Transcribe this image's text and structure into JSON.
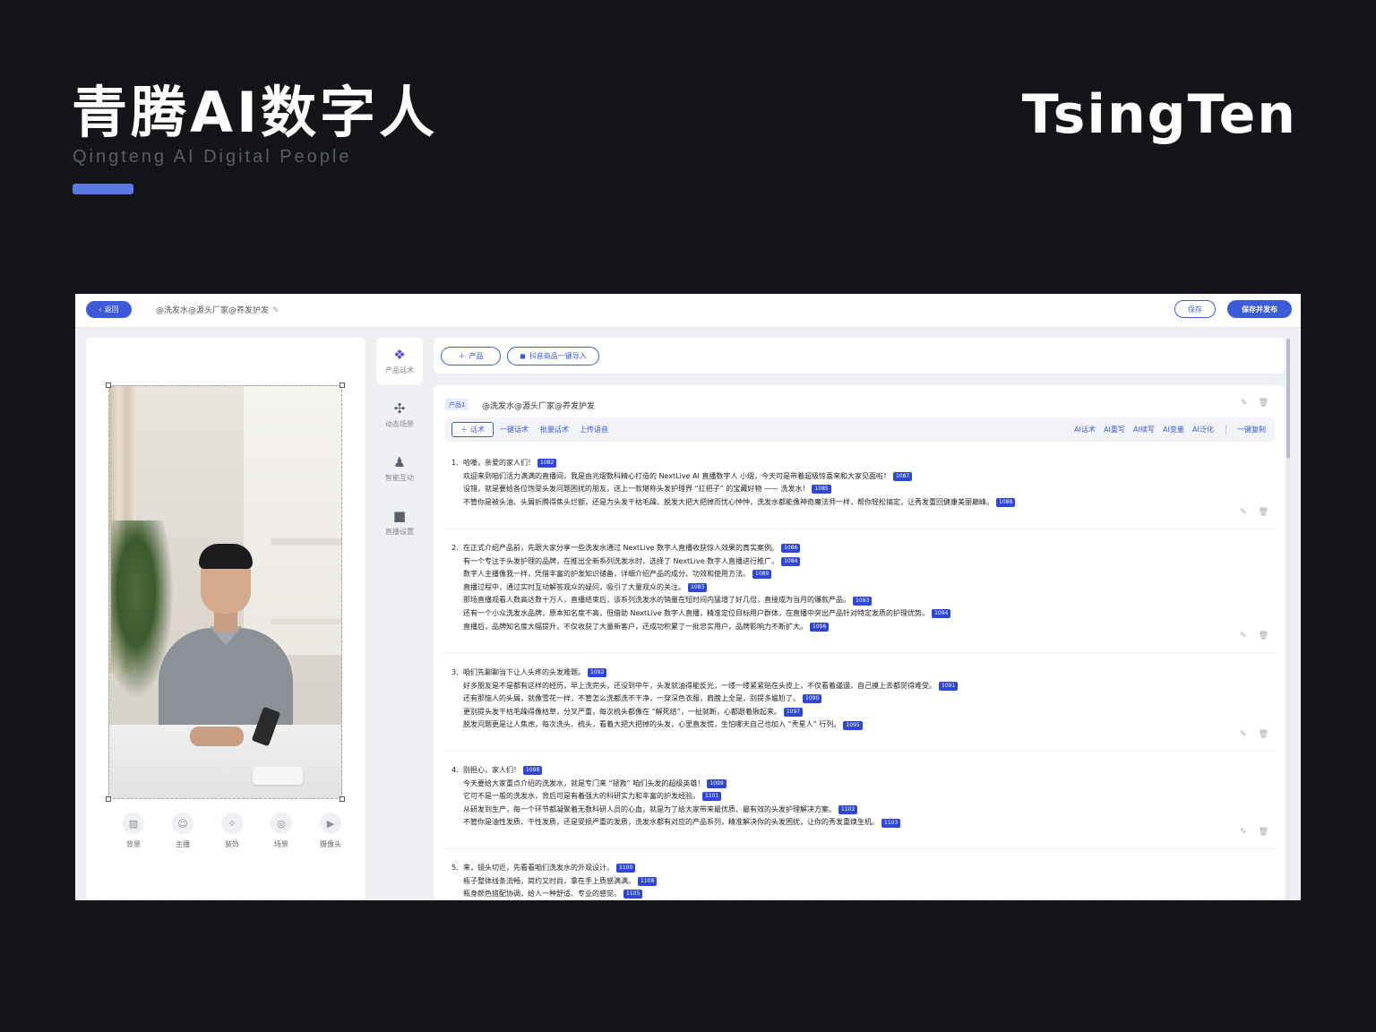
{
  "brand": {
    "title": "青腾AI数字人",
    "subtitle": "Qingteng AI Digital People",
    "logo": "TsingTen",
    "accent_color": "#5a78e6"
  },
  "topbar": {
    "back_label": "返回",
    "doc_title": "@洗发水@源头厂家@养发护发",
    "save_label": "保存",
    "publish_label": "保存并发布"
  },
  "preview": {
    "tools": [
      {
        "icon": "image-icon",
        "label": "背景"
      },
      {
        "icon": "anchor-icon",
        "label": "主播"
      },
      {
        "icon": "wand-icon",
        "label": "装饰"
      },
      {
        "icon": "scene-icon",
        "label": "场景"
      },
      {
        "icon": "camera-icon",
        "label": "摄像头"
      }
    ]
  },
  "nav": {
    "items": [
      {
        "icon": "product-script-icon",
        "label": "产品话术",
        "active": true
      },
      {
        "icon": "dynamic-scene-icon",
        "label": "动态场景",
        "active": false
      },
      {
        "icon": "robot-icon",
        "label": "智能互动",
        "active": false
      },
      {
        "icon": "video-icon",
        "label": "直播设置",
        "active": false
      }
    ]
  },
  "product_bar": {
    "add_product_label": "产品",
    "import_label": "抖音商品一键导入"
  },
  "card": {
    "tag": "产品1",
    "name": "@洗发水@源头厂家@养发护发",
    "tabs": {
      "add_label": "话术",
      "left_links": [
        "一键话术",
        "批量话术",
        "上传语音"
      ],
      "right_links": [
        "AI话术",
        "AI重写",
        "AI续写",
        "AI变量",
        "AI泛化"
      ],
      "copy_label": "一键复制"
    }
  },
  "scripts": [
    {
      "number": "1.",
      "lines": [
        {
          "text": "哈喽，亲爱的家人们！",
          "id": "1082"
        },
        {
          "text": "欢迎来到咱们活力满满的直播间，我是由兆熠数科精心打造的 NextLive AI 直播数字人 小熠，今天可是带着超级惊喜来和大家见面啦！",
          "id": "1087"
        },
        {
          "text": "没错，就是要给各位饱受头发问题困扰的朋友，送上一款堪称头发护理界 “扛把子” 的宝藏好物 —— 洗发水！",
          "id": "1085"
        },
        {
          "text": "不管你是被头油、头屑折腾得焦头烂额，还是为头发干枯毛躁、脱发大把大把掉而忧心忡忡，洗发水都能像神奇魔法师一样，帮你轻松搞定，让秀发重回健康美丽巅峰。",
          "id": "1088"
        }
      ]
    },
    {
      "number": "2.",
      "lines": [
        {
          "text": "在正式介绍产品前，先跟大家分享一些洗发水通过 NextLive 数字人直播收获惊人效果的真实案例。",
          "id": "1086"
        },
        {
          "text": "有一个专注于头发护理的品牌，在推出全新系列洗发水时，选择了 NextLive 数字人直播进行推广。",
          "id": "1084"
        },
        {
          "text": "数字人主播像我一样，凭借丰富的护发知识储备，详细介绍产品的成分、功效和使用方法。",
          "id": "1089"
        },
        {
          "text": "直播过程中，通过实时互动解答观众的疑问，吸引了大量观众的关注。",
          "id": "1083"
        },
        {
          "text": "那场直播观看人数高达数十万人，直播结束后，该系列洗发水的销量在短时间内猛增了好几倍，直接成为当月的爆款产品。",
          "id": "1093"
        },
        {
          "text": "还有一个小众洗发水品牌，原本知名度不高，但借助 NextLive 数字人直播，精准定位目标用户群体，在直播中突出产品针对特定发质的护理优势。",
          "id": "1094"
        },
        {
          "text": "直播后，品牌知名度大幅提升，不仅收获了大量新客户，还成功积累了一批忠实用户，品牌影响力不断扩大。",
          "id": "1096"
        }
      ]
    },
    {
      "number": "3.",
      "lines": [
        {
          "text": "咱们先聊聊当下让人头疼的头发难题。",
          "id": "1092"
        },
        {
          "text": "好多朋友是不是都有这样的经历，早上洗完头，还没到中午，头发就油得能反光，一缕一缕紧紧贴在头皮上，不仅看着邋遢，自己摸上去都觉得难受。",
          "id": "1091"
        },
        {
          "text": "还有那恼人的头屑，就像雪花一样，不管怎么洗都洗不干净，一穿深色衣服，肩膀上全是，别提多尴尬了。",
          "id": "1090"
        },
        {
          "text": "更别提头发干枯毛躁得像枯草，分叉严重，每次梳头都像在 “解死结”，一扯就断，心都跟着揪起来。",
          "id": "1097"
        },
        {
          "text": "脱发问题更是让人焦虑，每次洗头、梳头，看着大把大把掉的头发，心里直发慌，生怕哪天自己也加入 “秃星人” 行列。",
          "id": "1095"
        }
      ]
    },
    {
      "number": "4.",
      "lines": [
        {
          "text": "别担心，家人们！",
          "id": "1098"
        },
        {
          "text": "今天要给大家重点介绍的洗发水，就是专门来 “拯救” 咱们头发的超级英雄！",
          "id": "1099"
        },
        {
          "text": "它可不是一般的洗发水，背后可是有着强大的科研实力和丰富的护发经验。",
          "id": "1101"
        },
        {
          "text": "从研发到生产，每一个环节都凝聚着无数科研人员的心血，就是为了给大家带来最优质、最有效的头发护理解决方案。",
          "id": "1102"
        },
        {
          "text": "不管你是油性发质、干性发质，还是受损严重的发质，洗发水都有对应的产品系列，精准解决你的头发困扰，让你的秀发重焕生机。",
          "id": "1103"
        }
      ]
    },
    {
      "number": "5.",
      "lines": [
        {
          "text": "来，镜头切近，先看看咱们洗发水的外观设计。",
          "id": "1100"
        },
        {
          "text": "瓶子整体线条流畅，简约又时尚，拿在手上质感满满。",
          "id": "1108"
        },
        {
          "text": "瓶身颜色搭配协调，给人一种舒适、专业的感觉。",
          "id": "1105"
        }
      ]
    }
  ]
}
